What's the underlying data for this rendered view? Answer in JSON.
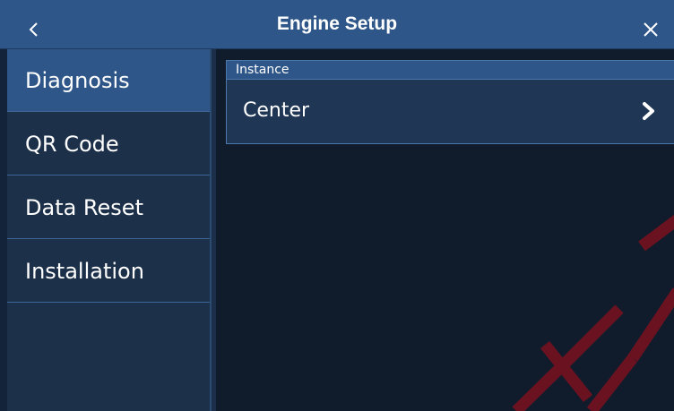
{
  "header": {
    "title": "Engine Setup",
    "back_icon": "chevron-left-icon",
    "close_icon": "close-icon"
  },
  "sidebar": {
    "items": [
      {
        "label": "Diagnosis",
        "active": true
      },
      {
        "label": "QR Code",
        "active": false
      },
      {
        "label": "Data Reset",
        "active": false
      },
      {
        "label": "Installation",
        "active": false
      }
    ]
  },
  "main": {
    "section_label": "Instance",
    "instance_value": "Center",
    "chevron_icon": "chevron-right-icon"
  },
  "colors": {
    "header_bg": "#2e5688",
    "sidebar_bg": "#1c3049",
    "main_bg": "#101c2c",
    "watermark": "#6b1220"
  }
}
